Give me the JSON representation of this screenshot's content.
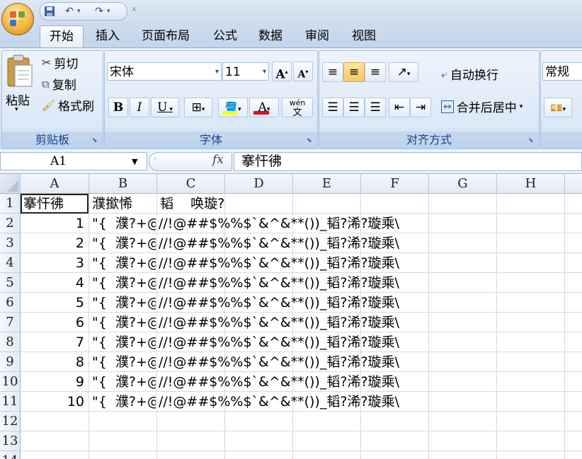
{
  "quick_access": {
    "save_icon": "save-icon",
    "undo_icon": "undo-icon",
    "redo_icon": "redo-icon",
    "customize_icon": "customize-icon"
  },
  "tabs": [
    "开始",
    "插入",
    "页面布局",
    "公式",
    "数据",
    "审阅",
    "视图"
  ],
  "clipboard": {
    "paste": "粘贴",
    "cut": "剪切",
    "copy": "复制",
    "format_painter": "格式刷",
    "label": "剪贴板"
  },
  "font": {
    "name": "宋体",
    "size": "11",
    "label": "字体",
    "bold": "B",
    "italic": "I",
    "underline": "U",
    "font_color_glyph": "A",
    "grow": "A",
    "shrink": "A",
    "wen": "wén"
  },
  "alignment": {
    "wrap": "自动换行",
    "merge": "合并后居中",
    "label": "对齐方式"
  },
  "number": {
    "format": "常规"
  },
  "formula_bar": {
    "name_box": "A1",
    "fx": "fx",
    "content": "搴忓彿"
  },
  "columns": [
    "A",
    "B",
    "C",
    "D",
    "E",
    "F",
    "G",
    "H"
  ],
  "rows": [
    "1",
    "2",
    "3",
    "4",
    "5",
    "6",
    "7",
    "8",
    "9",
    "10",
    "11",
    "12",
    "13",
    "14"
  ],
  "sheet": {
    "header_a": "搴忓彿",
    "header_b": "濮撳悕",
    "header_c": "韬    唤璇?",
    "data_rows": [
      {
        "a": "1",
        "b": "\"{  濮?+@#",
        "c": "//!@##$%%$`&^&**())_韬?浠?璇乘\\"
      },
      {
        "a": "2",
        "b": "\"{  濮?+@#",
        "c": "//!@##$%%$`&^&**())_韬?浠?璇乘\\"
      },
      {
        "a": "3",
        "b": "\"{  濮?+@#",
        "c": "//!@##$%%$`&^&**())_韬?浠?璇乘\\"
      },
      {
        "a": "4",
        "b": "\"{  濮?+@#",
        "c": "//!@##$%%$`&^&**())_韬?浠?璇乘\\"
      },
      {
        "a": "5",
        "b": "\"{  濮?+@#",
        "c": "//!@##$%%$`&^&**())_韬?浠?璇乘\\"
      },
      {
        "a": "6",
        "b": "\"{  濮?+@#",
        "c": "//!@##$%%$`&^&**())_韬?浠?璇乘\\"
      },
      {
        "a": "7",
        "b": "\"{  濮?+@#",
        "c": "//!@##$%%$`&^&**())_韬?浠?璇乘\\"
      },
      {
        "a": "8",
        "b": "\"{  濮?+@#",
        "c": "//!@##$%%$`&^&**())_韬?浠?璇乘\\"
      },
      {
        "a": "9",
        "b": "\"{  濮?+@#",
        "c": "//!@##$%%$`&^&**())_韬?浠?璇乘\\"
      },
      {
        "a": "10",
        "b": "\"{  濮?+@#",
        "c": "//!@##$%%$`&^&**())_韬?浠?璇乘\\"
      }
    ]
  },
  "colors": {
    "ribbon": "#dbe6f4",
    "header_text": "#15428b",
    "selected_button": "#f9c85e",
    "font_color_bar": "#e0101a",
    "highlight_bar": "#ffff00"
  }
}
